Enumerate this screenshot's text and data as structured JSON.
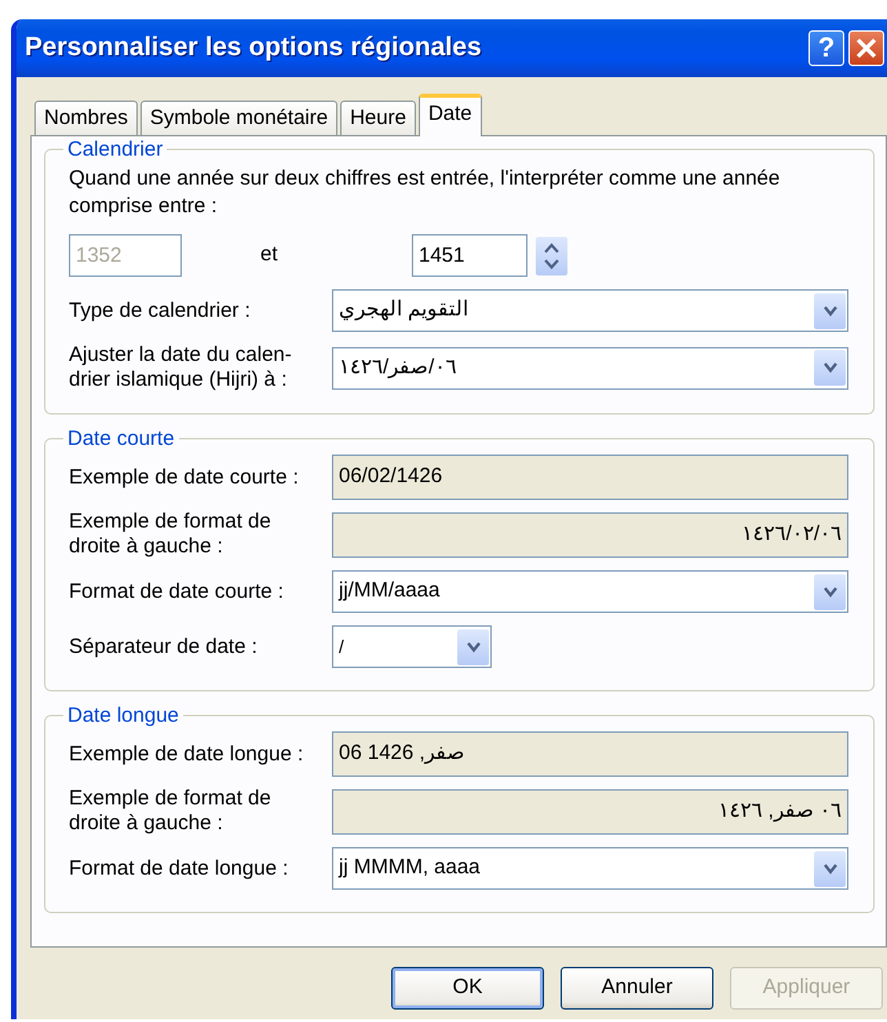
{
  "window": {
    "title": "Personnaliser les options régionales"
  },
  "title_buttons": [
    {
      "kind": "help",
      "label": "?"
    },
    {
      "kind": "close"
    }
  ],
  "tabs": [
    {
      "label": "Nombres",
      "selected": false
    },
    {
      "label": "Symbole monétaire",
      "selected": false
    },
    {
      "label": "Heure",
      "selected": false
    },
    {
      "label": "Date",
      "selected": true
    }
  ],
  "groups": [
    {
      "legend": "Calendrier",
      "rows": [
        {
          "kind": "note",
          "text": "Quand une année sur deux chiffres est entrée, l'interpréter comme une année comprise entre :"
        },
        {
          "kind": "range",
          "from": {
            "value": "1352",
            "disabled": true
          },
          "joiner": "et",
          "to": {
            "value": "1451",
            "disabled": false
          }
        },
        {
          "kind": "combo",
          "label": "Type de calendrier :",
          "value": "التقويم الهجري"
        },
        {
          "kind": "combo",
          "label": "Ajuster la date du calen-drier islamique (Hijri) à :",
          "value": "٠٦/صفر/١٤٢٦"
        }
      ]
    },
    {
      "legend": "Date courte",
      "rows": [
        {
          "kind": "readonly",
          "label": "Exemple de date courte :",
          "value": "06/02/1426",
          "right_aligned": false
        },
        {
          "kind": "readonly",
          "label": "Exemple de format de droite à gauche :",
          "value": "١٤٢٦/٠٢/٠٦",
          "right_aligned": true
        },
        {
          "kind": "combo",
          "label": "Format de date courte :",
          "value": "jj/MM/aaaa"
        },
        {
          "kind": "small_combo",
          "label": "Séparateur de date :",
          "value": "/"
        }
      ]
    },
    {
      "legend": "Date longue",
      "rows": [
        {
          "kind": "readonly",
          "label": "Exemple de date longue :",
          "value": "06 صفر, 1426",
          "right_aligned": false
        },
        {
          "kind": "readonly",
          "label": "Exemple de format de droite à gauche :",
          "value": "٠٦ صفر, ١٤٢٦",
          "right_aligned": true
        },
        {
          "kind": "combo",
          "label": "Format de date longue :",
          "value": "jj MMMM, aaaa"
        }
      ]
    }
  ],
  "buttons": [
    {
      "label": "OK",
      "disabled": false,
      "default": true
    },
    {
      "label": "Annuler",
      "disabled": false,
      "default": false
    },
    {
      "label": "Appliquer",
      "disabled": true,
      "default": false
    }
  ]
}
